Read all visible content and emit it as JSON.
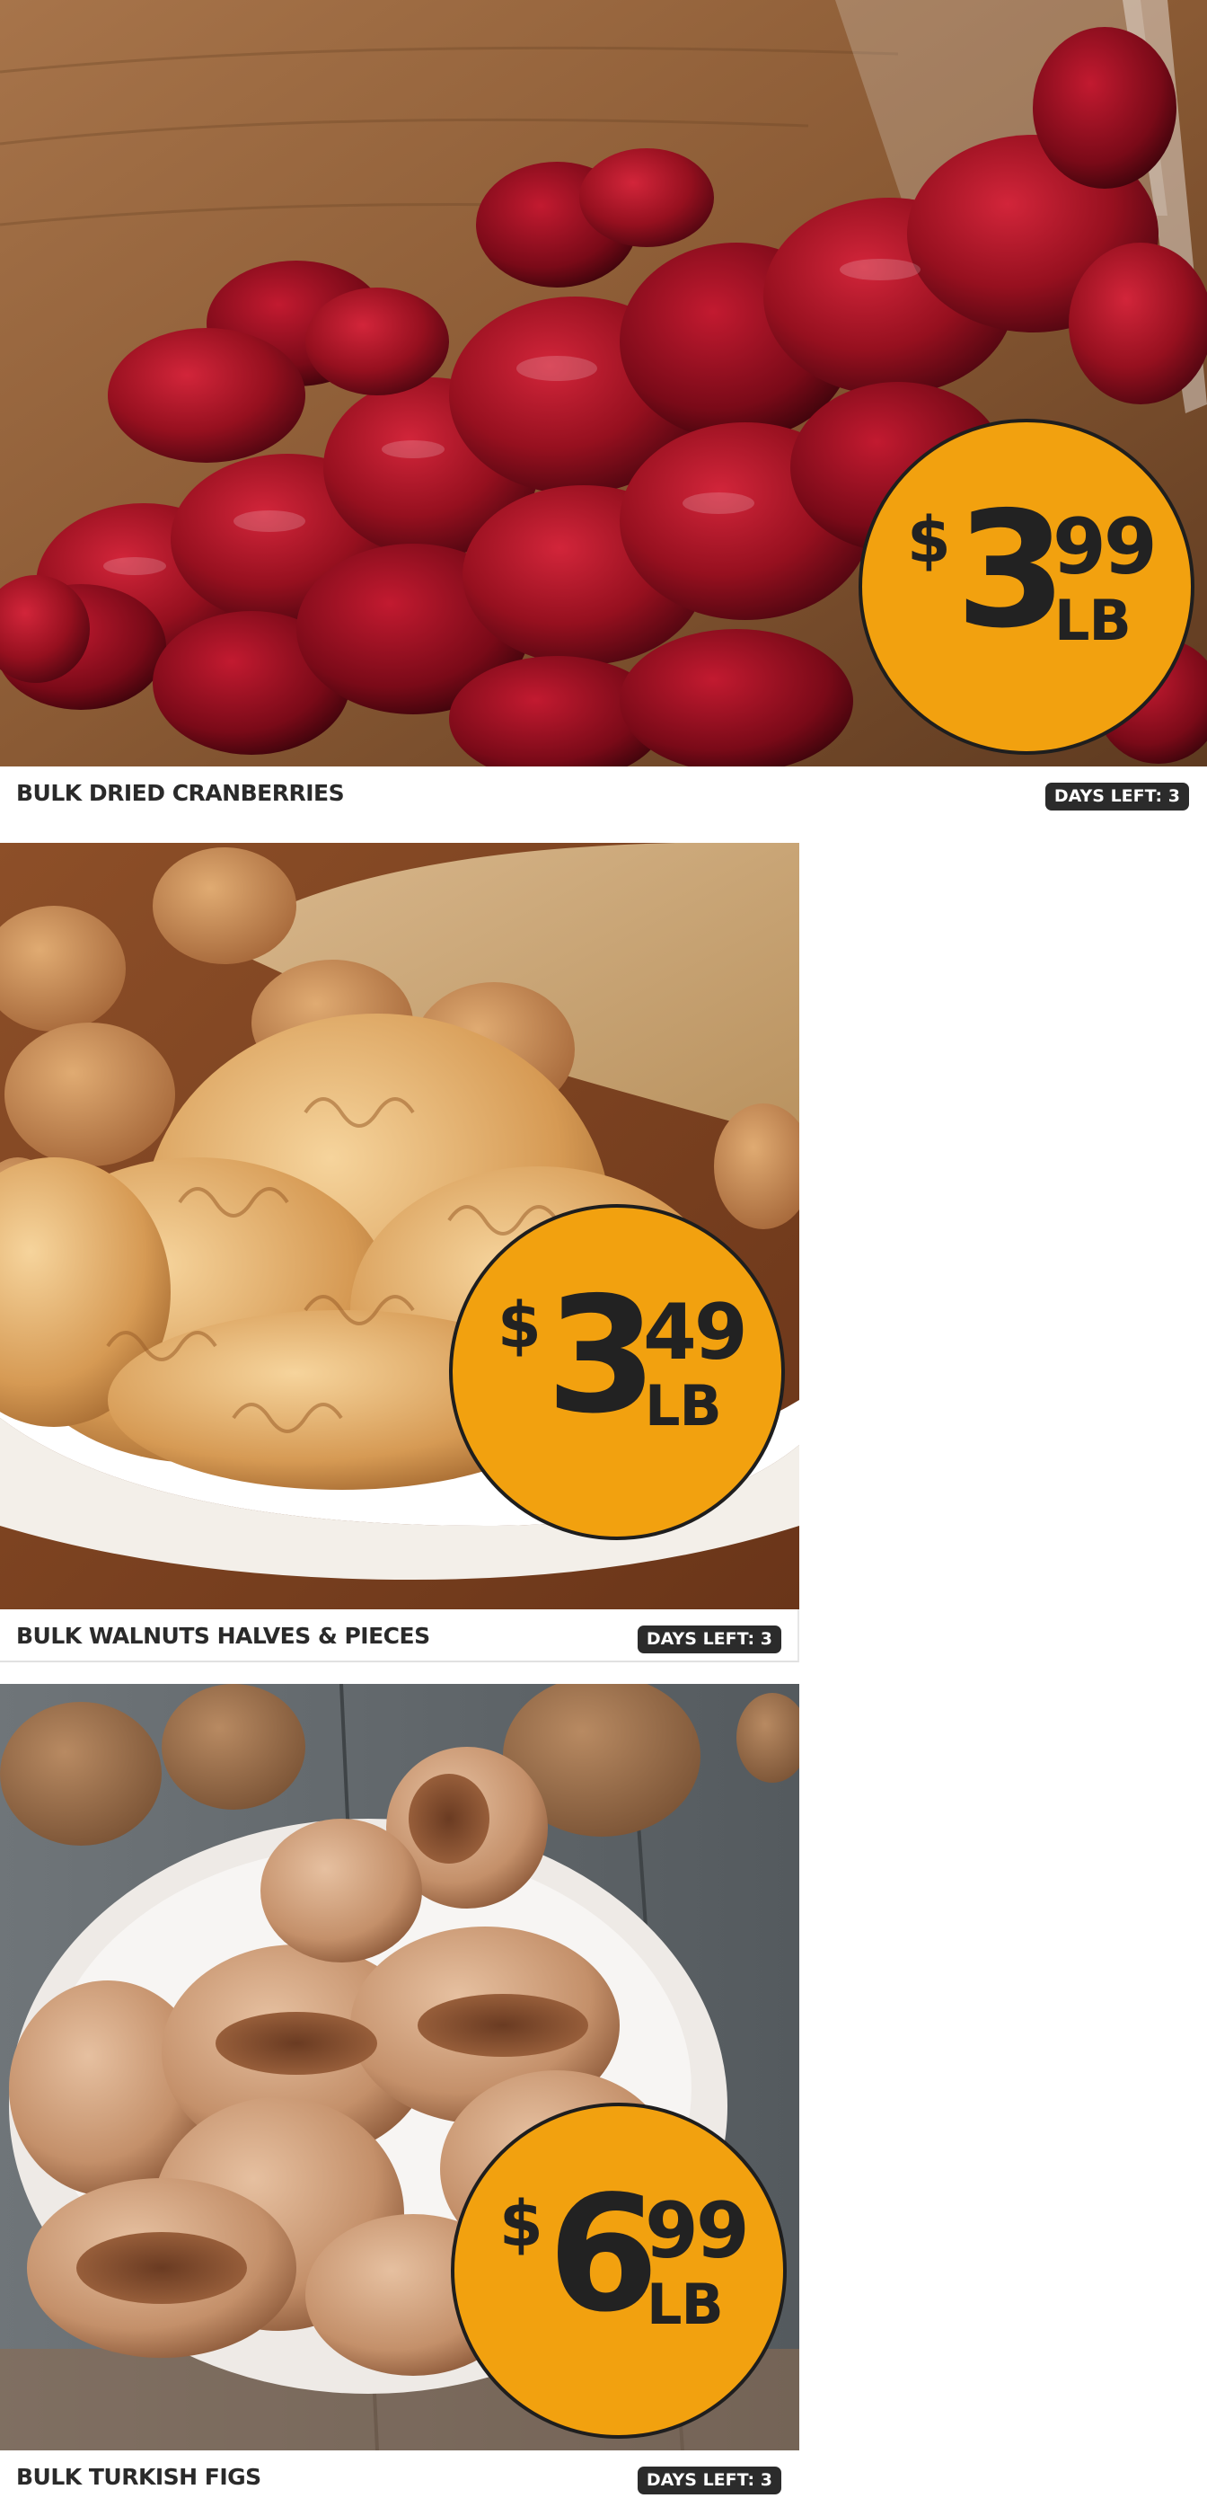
{
  "products": [
    {
      "name": "BULK DRIED CRANBERRIES",
      "price": {
        "currency": "$",
        "dollars": "3",
        "cents": "99",
        "unit": "LB"
      },
      "badge": "DAYS LEFT: 3",
      "image": "dried-cranberries-photo"
    },
    {
      "name": "BULK WALNUTS HALVES & PIECES",
      "price": {
        "currency": "$",
        "dollars": "3",
        "cents": "49",
        "unit": "LB"
      },
      "badge": "DAYS LEFT: 3",
      "image": "walnuts-photo"
    },
    {
      "name": "BULK TURKISH FIGS",
      "price": {
        "currency": "$",
        "dollars": "6",
        "cents": "99",
        "unit": "LB"
      },
      "badge": "DAYS LEFT: 3",
      "image": "turkish-figs-photo"
    }
  ],
  "colors": {
    "price_badge": "#f2a10f",
    "price_text": "#222222",
    "days_left_bg": "#2b2b2b",
    "page_bg": "#ffffff"
  }
}
